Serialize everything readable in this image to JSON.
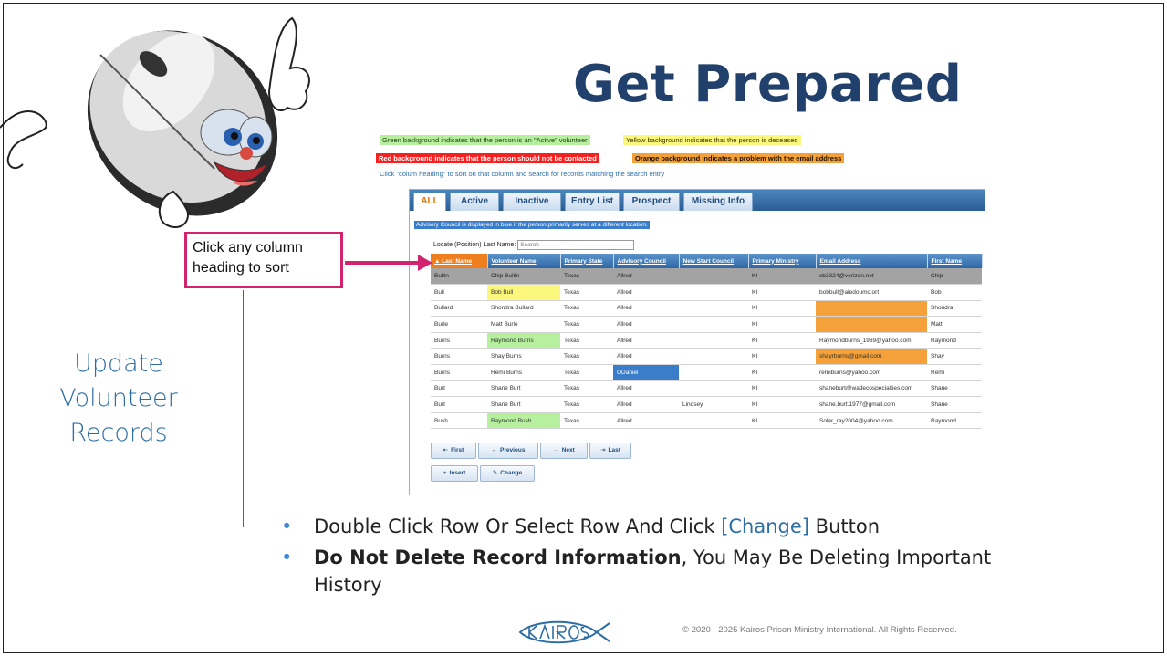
{
  "slide": {
    "title": "Get Prepared",
    "side_title": [
      "Update",
      "Volunteer",
      "Records"
    ],
    "callout": [
      "Click any column",
      "heading to sort"
    ],
    "bullets": [
      {
        "pre": "Double Click Row Or Select Row And Click ",
        "accent": "[Change]",
        "post": " Button"
      },
      {
        "bold": "Do Not Delete Record Information",
        "post": ", You May Be Deleting Important",
        "line2": "History"
      }
    ],
    "copyright": "© 2020 - 2025 Kairos Prison Ministry International. All Rights Reserved.",
    "logo_icon": "kairos-fish-logo-icon"
  },
  "legend": {
    "green": "Green background indicates that the person is an \"Active\" volunteer",
    "yellow": "Yellow background indicates that the person is deceased",
    "red": "Red background indicates that the person should not be contacted",
    "orange": "Orange background indicates a problem with the email address",
    "note": "Click \"colum heading\" to sort on that column and search for records matching the search entry"
  },
  "app": {
    "tabs": [
      "ALL",
      "Active",
      "Inactive",
      "Entry List",
      "Prospect",
      "Missing Info"
    ],
    "active_tab": "ALL",
    "advisory_note": "Advisory Council is displayed in blue if the person primarily serves at a different location.",
    "locate_label": "Locate (Position) Last Name:",
    "search_placeholder": "Search",
    "columns": [
      "▲ Last Name",
      "Volunteer Name",
      "Primary State",
      "Advisory Council",
      "New Start Council",
      "Primary Ministry",
      "Email Address",
      "First Name"
    ],
    "rows": [
      [
        "Bullin",
        "Chip Bullin",
        "Texas",
        "Allred",
        "",
        "KI",
        "cb3324@verizon.net",
        "Chip"
      ],
      [
        "Bull",
        "Bob Bull",
        "Texas",
        "Allred",
        "",
        "KI",
        "bobbull@aledoumc.ort",
        "Bob"
      ],
      [
        "Bullard",
        "Shondra Bullard",
        "Texas",
        "Allred",
        "",
        "KI",
        "",
        "Shondra"
      ],
      [
        "Burle",
        "Matt Burle",
        "Texas",
        "Allred",
        "",
        "KI",
        "",
        "Matt"
      ],
      [
        "Burns",
        "Raymond Burns",
        "Texas",
        "Allred",
        "",
        "KI",
        "Raymondburns_1969@yahoo.com",
        "Raymond"
      ],
      [
        "Burns",
        "Shay Burns",
        "Texas",
        "Allred",
        "",
        "KI",
        "shayrburns@gmail.com",
        "Shay"
      ],
      [
        "Burns",
        "Remi Burns",
        "Texas",
        "ODaniel",
        "",
        "KI",
        "remiburns@yahoo.com",
        "Remi"
      ],
      [
        "Burt",
        "Shane Burt",
        "Texas",
        "Allred",
        "",
        "KI",
        "shaneburt@wadecospecialties.com",
        "Shane"
      ],
      [
        "Burt",
        "Shane Burt",
        "Texas",
        "Allred",
        "Lindsey",
        "KI",
        "shane.burt.1977@gmail.com",
        "Shane"
      ],
      [
        "Bush",
        "Raymond Bush",
        "Texas",
        "Allred",
        "",
        "KI",
        "Solar_ray2004@yahoo.com",
        "Raymond"
      ]
    ],
    "pager": {
      "first": "First",
      "previous": "Previous",
      "next": "Next",
      "last": "Last"
    },
    "actions": {
      "insert": "Insert",
      "change": "Change"
    }
  }
}
